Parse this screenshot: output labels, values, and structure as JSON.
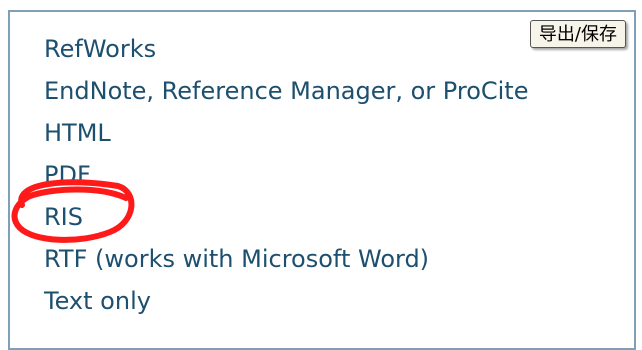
{
  "export_button": {
    "label": "导出/保存"
  },
  "formats": [
    {
      "label": "RefWorks"
    },
    {
      "label": "EndNote, Reference Manager, or ProCite"
    },
    {
      "label": "HTML"
    },
    {
      "label": "PDF"
    },
    {
      "label": "RIS"
    },
    {
      "label": "RTF (works with Microsoft Word)"
    },
    {
      "label": "Text only"
    }
  ],
  "annotation": {
    "color": "#ff1a1a",
    "target": "RIS"
  }
}
